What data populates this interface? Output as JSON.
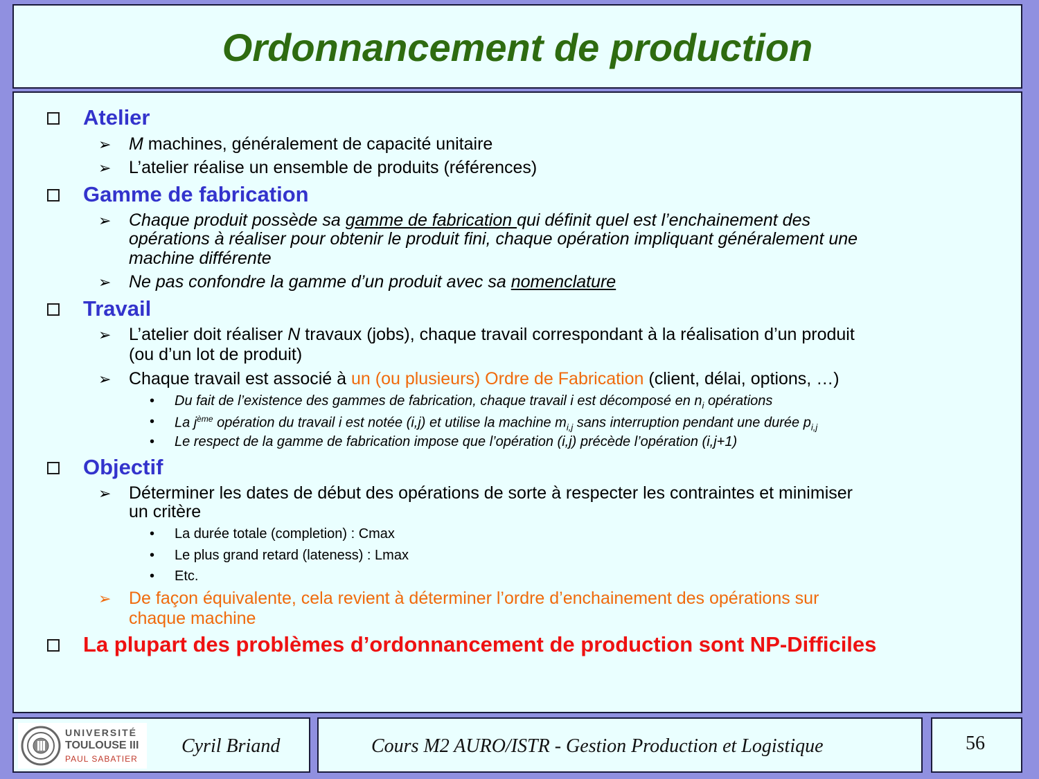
{
  "title": "Ordonnancement de production",
  "sections": [
    {
      "heading": "Atelier",
      "items": [
        {
          "var": "M",
          "rest": " machines, généralement de capacité unitaire"
        },
        {
          "text": "L’atelier réalise un ensemble de produits (références)"
        }
      ]
    },
    {
      "heading": "Gamme de fabrication",
      "items": [
        {
          "pre": "Chaque produit possède sa ",
          "underlined": "gamme de fabrication ",
          "post": "qui définit quel est l’enchainement des",
          "line2": "opérations à réaliser pour obtenir le produit fini, chaque opération impliquant généralement une",
          "line3": "machine différente"
        },
        {
          "pre": "Ne pas confondre la gamme d’un produit avec sa ",
          "underlined": "nomenclature"
        }
      ]
    },
    {
      "heading": "Travail",
      "items": [
        {
          "pre": "L’atelier doit réaliser ",
          "var": "N",
          "post": " travaux (jobs), chaque travail correspondant à la réalisation d’un produit",
          "line2": "(ou d’un lot de produit)"
        },
        {
          "pre": "Chaque travail est associé à ",
          "highlight": "un (ou plusieurs) Ordre de Fabrication",
          "post": " (client, délai, options, …)"
        }
      ],
      "subitems": [
        {
          "text": "Du fait de l’existence des gammes de fabrication, chaque travail i est décomposé en n",
          "sub": "i",
          "end": " opérations"
        },
        {
          "a": "La j",
          "sup": "ème",
          "b": " opération du travail i est notée (i,j) et utilise la machine m",
          "sub1": "i,j",
          "c": " sans interruption pendant une durée p",
          "sub2": "i,j"
        },
        {
          "text": "Le respect de la gamme de fabrication impose que l’opération (i,j) précède l’opération (i,j+1)"
        }
      ]
    },
    {
      "heading": "Objectif",
      "items": [
        {
          "text": "Déterminer les dates de début des opérations de sorte à respecter les contraintes et minimiser",
          "line2": "un critère"
        }
      ],
      "subitems": [
        {
          "text": "La durée totale (completion) : Cmax"
        },
        {
          "text": "Le plus grand retard (lateness) :  Lmax"
        },
        {
          "text": "Etc."
        }
      ],
      "note": {
        "line1": "De façon équivalente, cela revient à déterminer l’ordre d’enchainement des opérations sur",
        "line2": "chaque machine"
      }
    }
  ],
  "conclusion": "La plupart des problèmes d’ordonnancement de production sont NP-Difficiles",
  "footer": {
    "logo": {
      "line1": "UNIVERSITÉ",
      "line2": "TOULOUSE III",
      "line3": "PAUL SABATIER"
    },
    "author": "Cyril Briand",
    "course": "Cours M2 AURO/ISTR - Gestion Production et Logistique",
    "page": "56"
  },
  "colors": {
    "background": "#9090e0",
    "panel": "#eaffff",
    "title": "#2e6b10",
    "heading": "#3333cc",
    "accent": "#f06a0c",
    "alert": "#ee1111"
  },
  "icons": {
    "level1": "hollow-square-bullet",
    "level2": "arrow-bullet",
    "level3": "dot-bullet"
  }
}
